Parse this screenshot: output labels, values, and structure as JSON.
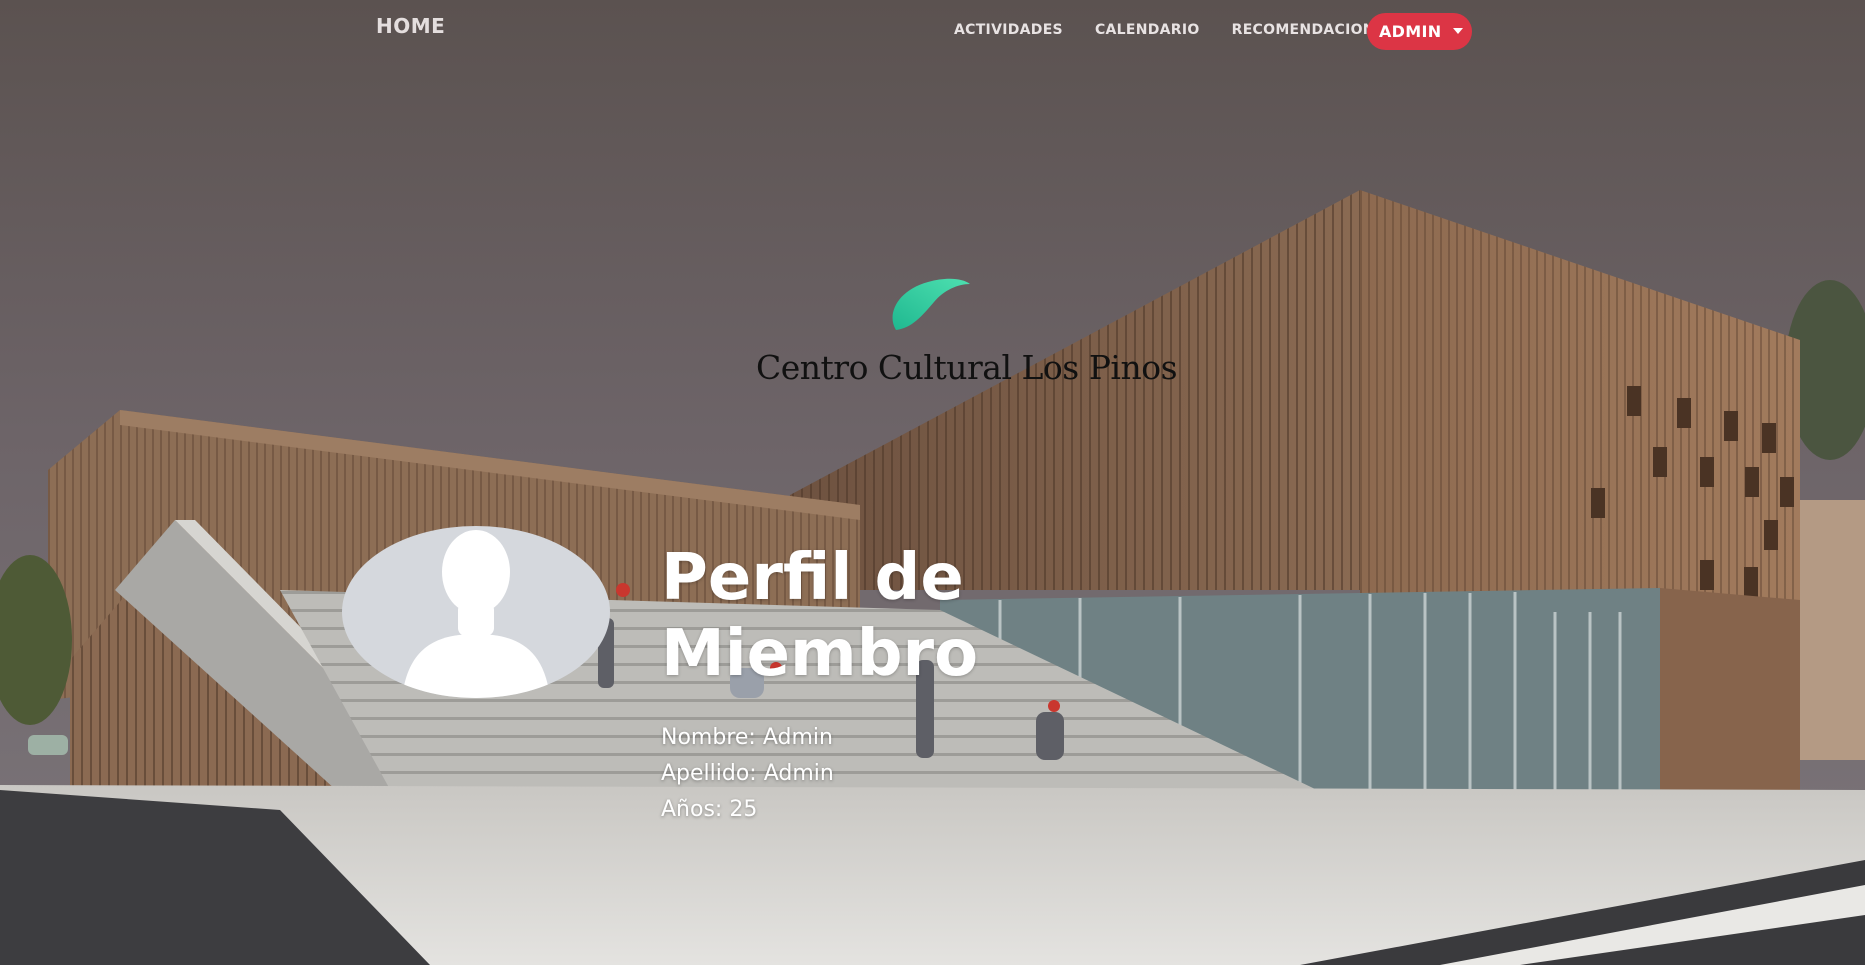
{
  "navbar": {
    "home_label": "HOME",
    "links": [
      {
        "label": "ACTIVIDADES"
      },
      {
        "label": "CALENDARIO"
      },
      {
        "label": "RECOMENDACIONES"
      }
    ],
    "user_menu": {
      "label": "ADMIN",
      "icon": "chevron-down-icon",
      "color": "#dc3545"
    }
  },
  "logo": {
    "text": "Centro Cultural Los Pinos",
    "icon": "leaf-icon",
    "accent_color": "#2ec99a"
  },
  "profile": {
    "title": "Perfil de Miembro",
    "avatar_icon": "user-silhouette-icon",
    "fields": [
      {
        "label": "Nombre: Admin"
      },
      {
        "label": "Apellido: Admin"
      },
      {
        "label": "Años: 25"
      }
    ]
  }
}
